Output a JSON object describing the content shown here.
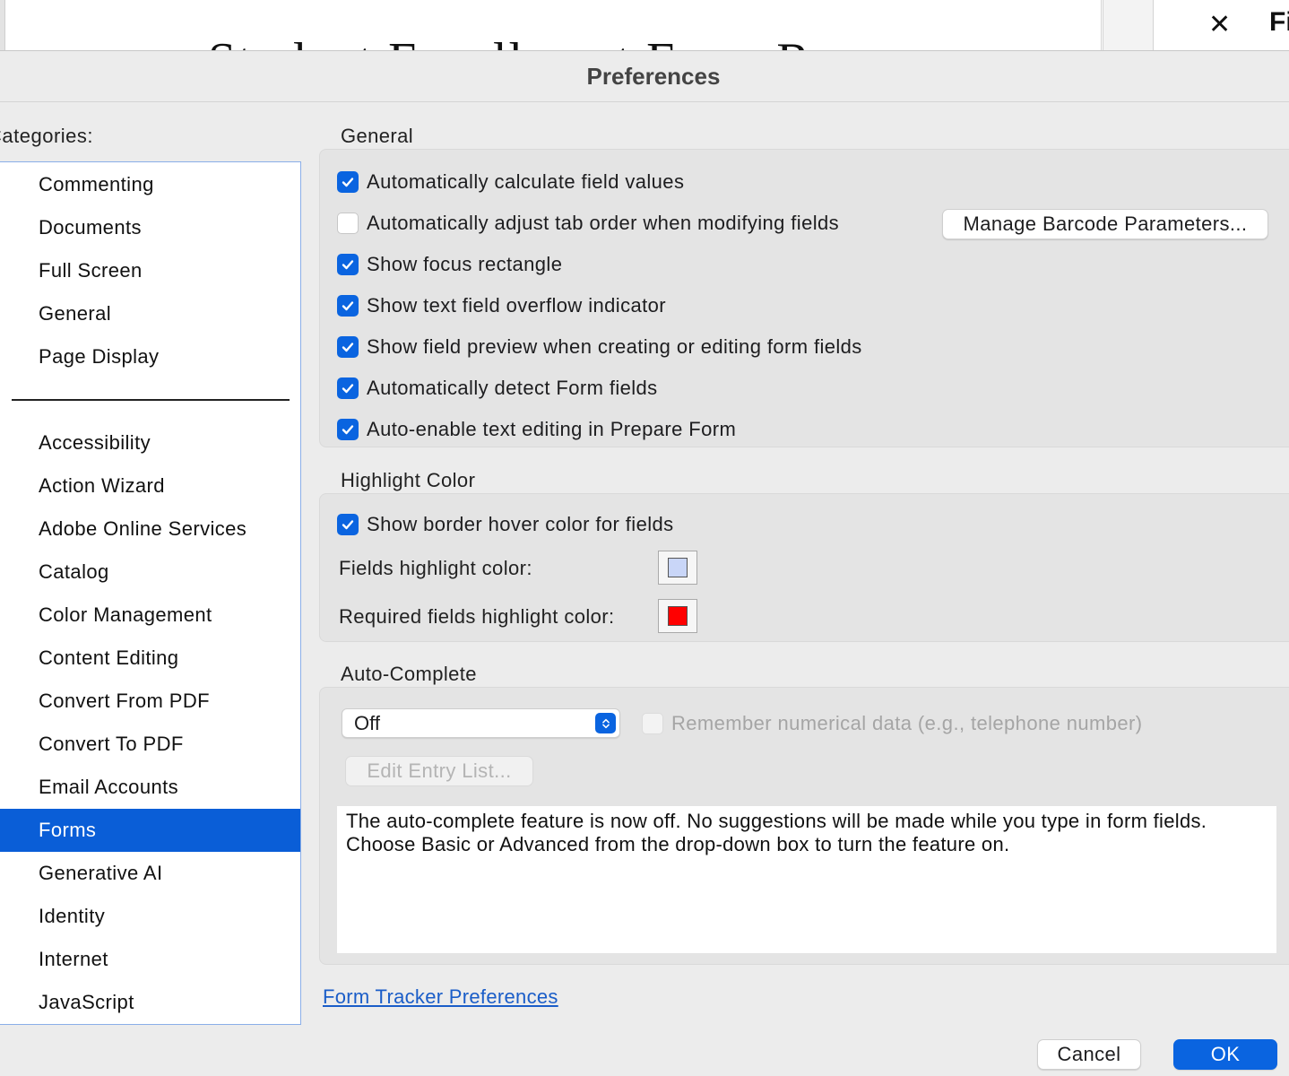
{
  "background": {
    "doc_text": "Student Enrollment Form R",
    "close_glyph": "✕",
    "side_text": "Fi"
  },
  "dialog": {
    "title": "Preferences",
    "categories_label": "Categories:",
    "categories_group1": [
      "Commenting",
      "Documents",
      "Full Screen",
      "General",
      "Page Display"
    ],
    "categories_group2": [
      "Accessibility",
      "Action Wizard",
      "Adobe Online Services",
      "Catalog",
      "Color Management",
      "Content Editing",
      "Convert From PDF",
      "Convert To PDF",
      "Email Accounts",
      "Forms",
      "Generative AI",
      "Identity",
      "Internet",
      "JavaScript"
    ],
    "selected_category": "Forms"
  },
  "general": {
    "title": "General",
    "options": [
      {
        "label": "Automatically calculate field values",
        "checked": true
      },
      {
        "label": "Automatically adjust tab order when modifying fields",
        "checked": false
      },
      {
        "label": "Show focus rectangle",
        "checked": true
      },
      {
        "label": "Show text field overflow indicator",
        "checked": true
      },
      {
        "label": "Show field preview when creating or editing form fields",
        "checked": true
      },
      {
        "label": "Automatically detect Form fields",
        "checked": true
      },
      {
        "label": "Auto-enable text editing in Prepare Form",
        "checked": true
      }
    ],
    "barcode_button": "Manage Barcode Parameters..."
  },
  "highlight": {
    "title": "Highlight Color",
    "hover_option": {
      "label": "Show border hover color for fields",
      "checked": true
    },
    "fields_label": "Fields highlight color:",
    "fields_color": "#c9d6f8",
    "required_label": "Required fields highlight color:",
    "required_color": "#ff0000"
  },
  "autocomplete": {
    "title": "Auto-Complete",
    "mode": "Off",
    "remember_label": "Remember numerical data (e.g., telephone number)",
    "remember_checked": false,
    "edit_button": "Edit Entry List...",
    "description_line1": "The auto-complete feature is now off. No suggestions will be made while you type in form fields.",
    "description_line2": "Choose Basic or Advanced from the drop-down box to turn the feature on."
  },
  "footer": {
    "link": "Form Tracker Preferences",
    "cancel": "Cancel",
    "ok": "OK"
  },
  "colors": {
    "accent": "#0a64e0",
    "selection": "#0a5ed7",
    "link": "#1a5dc8"
  }
}
